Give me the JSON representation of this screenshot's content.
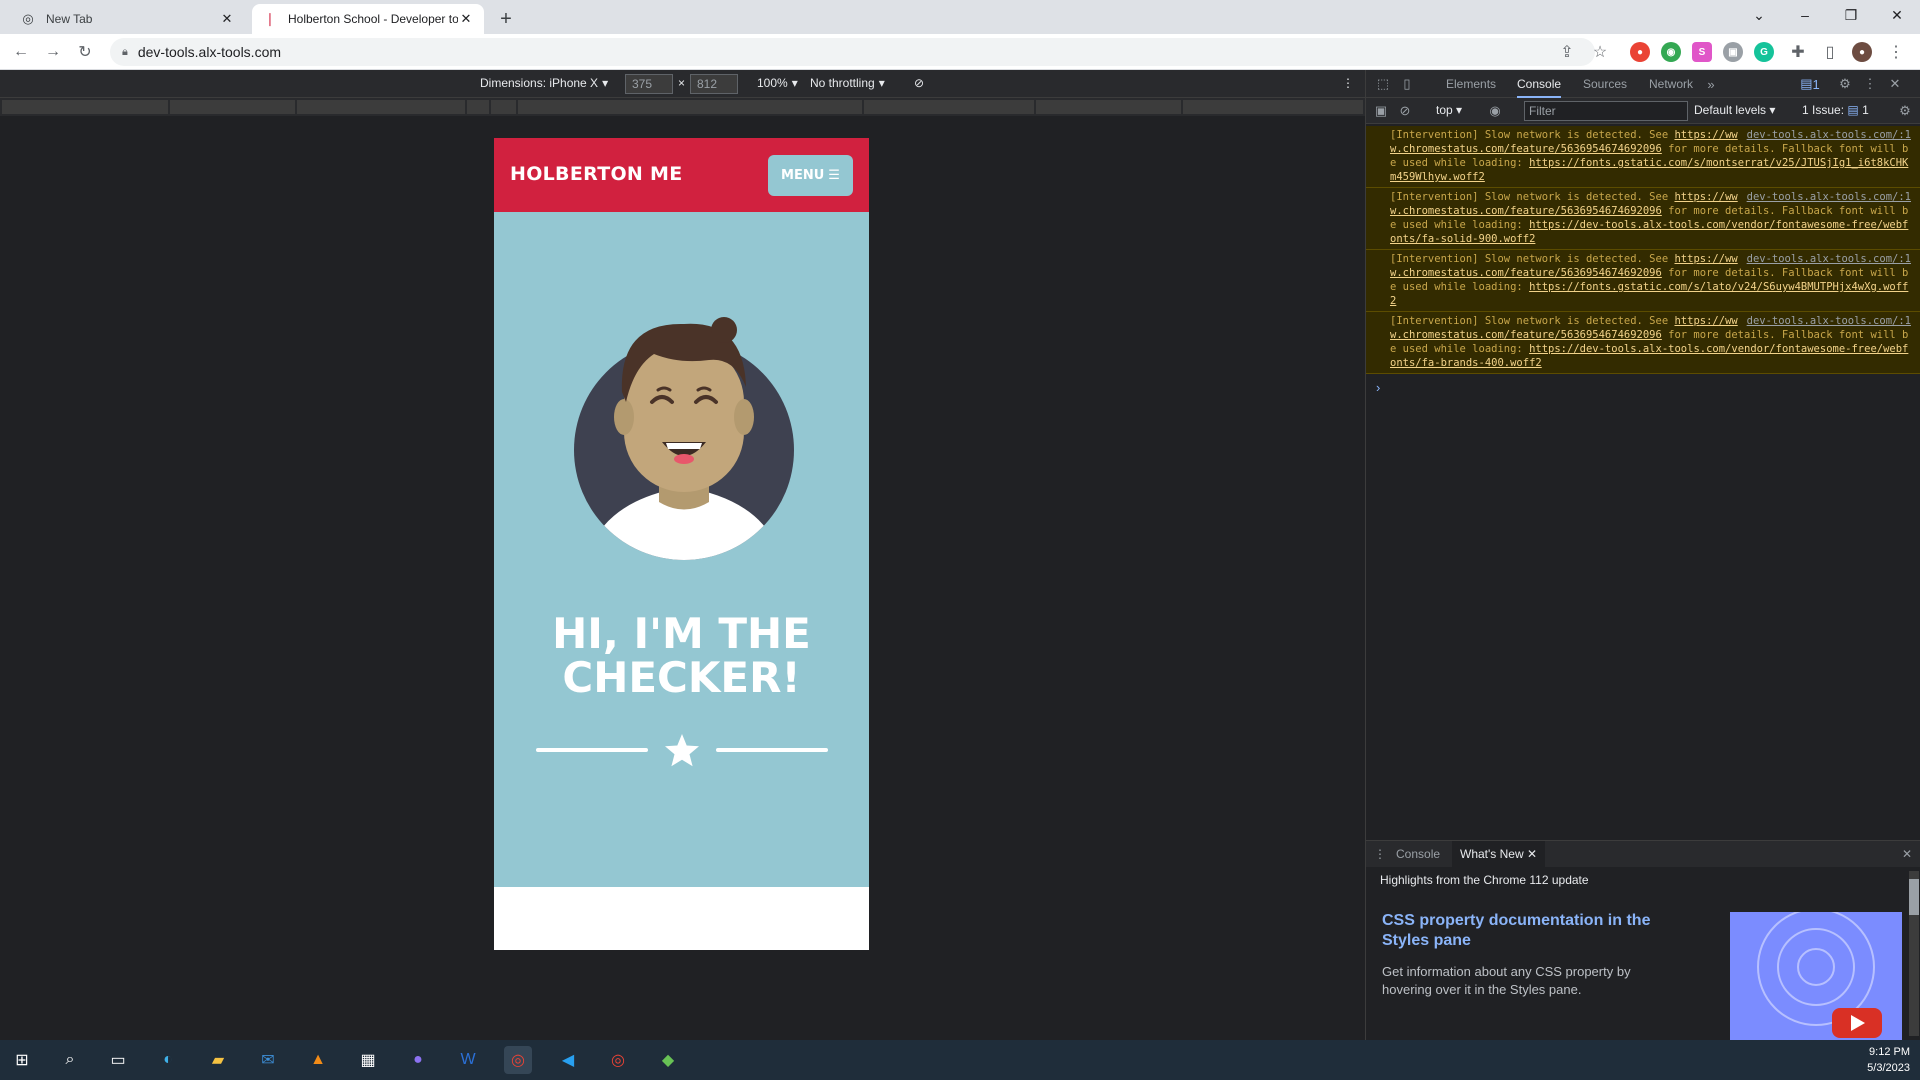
{
  "browser": {
    "tabs": [
      {
        "title": "New Tab",
        "active": false
      },
      {
        "title": "Holberton School - Developer to",
        "active": true
      }
    ],
    "url": "dev-tools.alx-tools.com"
  },
  "device_toolbar": {
    "dimensions_label": "Dimensions: iPhone X",
    "width": "375",
    "height": "812",
    "times": "×",
    "zoom": "100%",
    "throttling": "No throttling"
  },
  "site": {
    "brand": "HOLBERTON ME",
    "menu_label": "MENU",
    "hero_title": "HI, I'M THE CHECKER!",
    "colors": {
      "header": "#d1213f",
      "hero": "#94c7d2"
    }
  },
  "devtools": {
    "tabs": [
      "Elements",
      "Console",
      "Sources",
      "Network"
    ],
    "active_tab": "Console",
    "issue_badge": "1",
    "context": "top",
    "filter_placeholder": "Filter",
    "levels": "Default levels",
    "issues": "1 Issue:",
    "issues_count": "1",
    "messages": [
      {
        "text": "[Intervention] Slow network is detected. See ",
        "link1": "http",
        "source": "dev-tools.alx-tools.com/:1",
        "link2": "s://www.chromestatus.com/feature/5636954674692096",
        "text2": " for more details. Fallback font will be used while loading: ",
        "font_url": "https://fonts.gstatic.com/s/montserrat/v25/JTUSjIg1_i6t8kCHKm459Wlhyw.woff2"
      },
      {
        "text": "[Intervention] Slow network is detected. See ",
        "link1": "http",
        "source": "dev-tools.alx-tools.com/:1",
        "link2": "s://www.chromestatus.com/feature/5636954674692096",
        "text2": " for more details. Fallback font will be used while loading: ",
        "font_url": "https://dev-tools.alx-tools.com/vendor/fontawesome-free/webfonts/fa-solid-900.woff2"
      },
      {
        "text": "[Intervention] Slow network is detected. See ",
        "link1": "http",
        "source": "dev-tools.alx-tools.com/:1",
        "link2": "s://www.chromestatus.com/feature/5636954674692096",
        "text2": " for more details. Fallback font will be used while loading: ",
        "font_url": "https://fonts.gstatic.com/s/lato/v24/S6uyw4BMUTPHjx4wXg.woff2"
      },
      {
        "text": "[Intervention] Slow network is detected. See ",
        "link1": "http",
        "source": "dev-tools.alx-tools.com/:1",
        "link2": "s://www.chromestatus.com/feature/5636954674692096",
        "text2": " for more details. Fallback font will be used while loading: ",
        "font_url": "https://dev-tools.alx-tools.com/vendor/fontawesome-free/webfonts/fa-brands-400.woff2"
      }
    ],
    "drawer": {
      "tabs": [
        "Console",
        "What's New"
      ],
      "active_tab": "What's New",
      "highlights": "Highlights from the Chrome 112 update",
      "card_title": "CSS property documentation in the Styles pane",
      "card_desc": "Get information about any CSS property by hovering over it in the Styles pane."
    }
  },
  "taskbar": {
    "time": "9:12 PM",
    "date": "5/3/2023"
  }
}
